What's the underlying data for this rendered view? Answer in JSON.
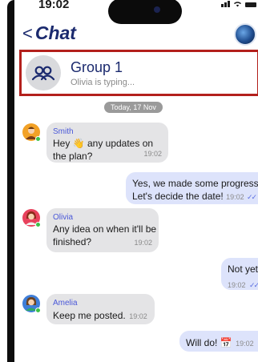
{
  "status_bar": {
    "time": "19:02"
  },
  "nav": {
    "back_glyph": "<",
    "title": "Chat"
  },
  "group": {
    "name": "Group 1",
    "status": "Olivia is typing..."
  },
  "date_separator": "Today, 17 Nov",
  "messages": [
    {
      "sender": "Smith",
      "text_part1": "Hey ",
      "emoji": "👋",
      "text_part2": " any updates on the plan?",
      "time": "19:02",
      "incoming": true
    },
    {
      "text_line1": "Yes, we made some progress.",
      "text_line2": "Let's decide the date!",
      "time": "19:02",
      "ticks": "✓✓",
      "incoming": false
    },
    {
      "sender": "Olivia",
      "text_line1": "Any idea on when it'll be",
      "text_line2": "finished?",
      "time": "19:02",
      "incoming": true
    },
    {
      "text": "Not yet",
      "time": "19:02",
      "ticks": "✓✓",
      "incoming": false
    },
    {
      "sender": "Amelia",
      "text": "Keep me posted.",
      "time": "19:02",
      "incoming": true
    },
    {
      "text_part": "Will do! ",
      "emoji": "📅",
      "time": "19:02",
      "ticks": "✓✓",
      "incoming": false
    }
  ],
  "colors": {
    "accent": "#1b2a6e",
    "highlight_border": "#b3201c",
    "incoming_bubble": "#e4e4e6",
    "outgoing_bubble": "#dde3fb",
    "sender_name": "#4a58d8",
    "online": "#3cc04a"
  }
}
